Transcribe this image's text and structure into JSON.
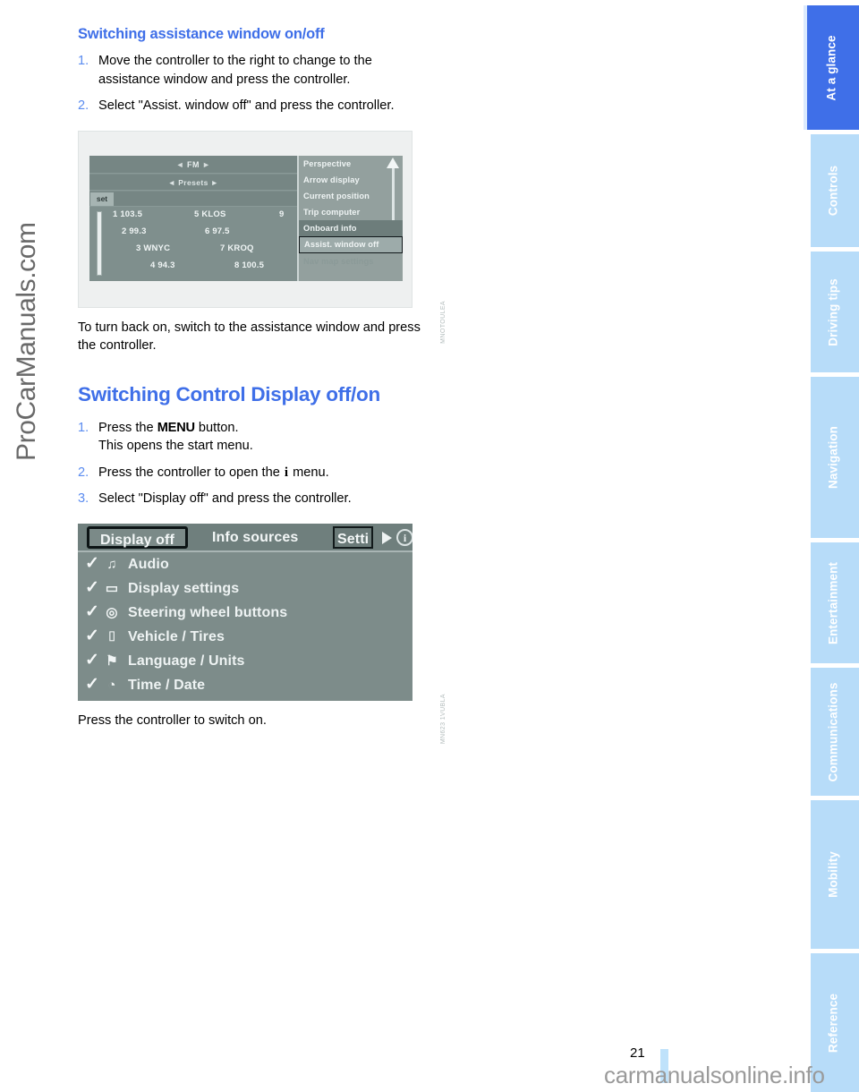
{
  "document": {
    "page_number": "21",
    "left_watermark": "ProCarManuals.com",
    "bottom_watermark": "carmanualsonline.info"
  },
  "section_one": {
    "title": "Switching assistance window on/off",
    "steps": [
      {
        "num": "1.",
        "text": "Move the controller to the right to change to the assistance window and press the controller."
      },
      {
        "num": "2.",
        "text": "Select \"Assist. window off\" and press the controller."
      }
    ],
    "after_figure_text": "To turn back on, switch to the assistance window and press the controller."
  },
  "figure_one": {
    "code": "MNOTOULEA",
    "radio": {
      "band_label": "FM",
      "band_left_arrow": "◄",
      "band_right_arrow": "►",
      "presets_label": "◄ Presets ►",
      "set_button": "set",
      "stations": [
        {
          "left": "1 103.5",
          "mid": "5 KLOS",
          "right": "9"
        },
        {
          "left": "2 99.3",
          "mid": "6 97.5",
          "right": ""
        },
        {
          "left": "3 WNYC",
          "mid": "7 KROQ",
          "right": ""
        },
        {
          "left": "4 94.3",
          "mid": "8 100.5",
          "right": ""
        }
      ]
    },
    "assistance_menu": [
      {
        "label": "Perspective",
        "state": "normal"
      },
      {
        "label": "Arrow display",
        "state": "normal"
      },
      {
        "label": "Current position",
        "state": "normal"
      },
      {
        "label": "Trip computer",
        "state": "normal"
      },
      {
        "label": "Onboard info",
        "state": "highlighted"
      },
      {
        "label": "Assist. window off",
        "state": "selected"
      },
      {
        "label": "Nav map  settings",
        "state": "dimmed"
      }
    ]
  },
  "section_two": {
    "title": "Switching Control Display off/on",
    "steps": [
      {
        "num": "1.",
        "text_before": "Press the ",
        "bold": "MENU",
        "text_after": " button.",
        "second_line": "This opens the start menu."
      },
      {
        "num": "2.",
        "text_before": "Press the controller to open the ",
        "glyph": "i",
        "text_after": " menu."
      },
      {
        "num": "3.",
        "text": "Select \"Display off\" and press the controller."
      }
    ],
    "after_figure_text": "Press the controller to switch on."
  },
  "figure_two": {
    "code": "MN623 1VUBLA",
    "tabs": [
      {
        "label": "Display off",
        "state": "focused"
      },
      {
        "label": "Info sources",
        "state": "normal"
      },
      {
        "label": "Setti",
        "state": "boxed"
      }
    ],
    "next_arrow_icon": "triangle-right-icon",
    "info_icon_label": "i",
    "menu_rows": [
      {
        "check": "✓",
        "icon": "audio-icon",
        "glyph": "♫",
        "label": "Audio"
      },
      {
        "check": "✓",
        "icon": "display-icon",
        "glyph": "▭",
        "label": "Display settings"
      },
      {
        "check": "✓",
        "icon": "steering-wheel-icon",
        "glyph": "◎",
        "label": "Steering wheel buttons"
      },
      {
        "check": "✓",
        "icon": "car-icon",
        "glyph": "⌷",
        "label": "Vehicle / Tires"
      },
      {
        "check": "✓",
        "icon": "flag-icon",
        "glyph": "⚑",
        "label": "Language / Units"
      },
      {
        "check": "✓",
        "icon": "clock-icon",
        "glyph": "◔",
        "label": "Time / Date"
      }
    ]
  },
  "rail": {
    "tabs": [
      {
        "label": "At a glance",
        "active": true
      },
      {
        "label": "Controls",
        "active": false
      },
      {
        "label": "Driving tips",
        "active": false
      },
      {
        "label": "Navigation",
        "active": false
      },
      {
        "label": "Entertainment",
        "active": false
      },
      {
        "label": "Communications",
        "active": false
      },
      {
        "label": "Mobility",
        "active": false
      },
      {
        "label": "Reference",
        "active": false
      }
    ]
  },
  "colors": {
    "accent_blue": "#3f6fe8",
    "tab_light_blue": "#b7dcf9",
    "screenshot_gray": "#7d8c8a"
  }
}
